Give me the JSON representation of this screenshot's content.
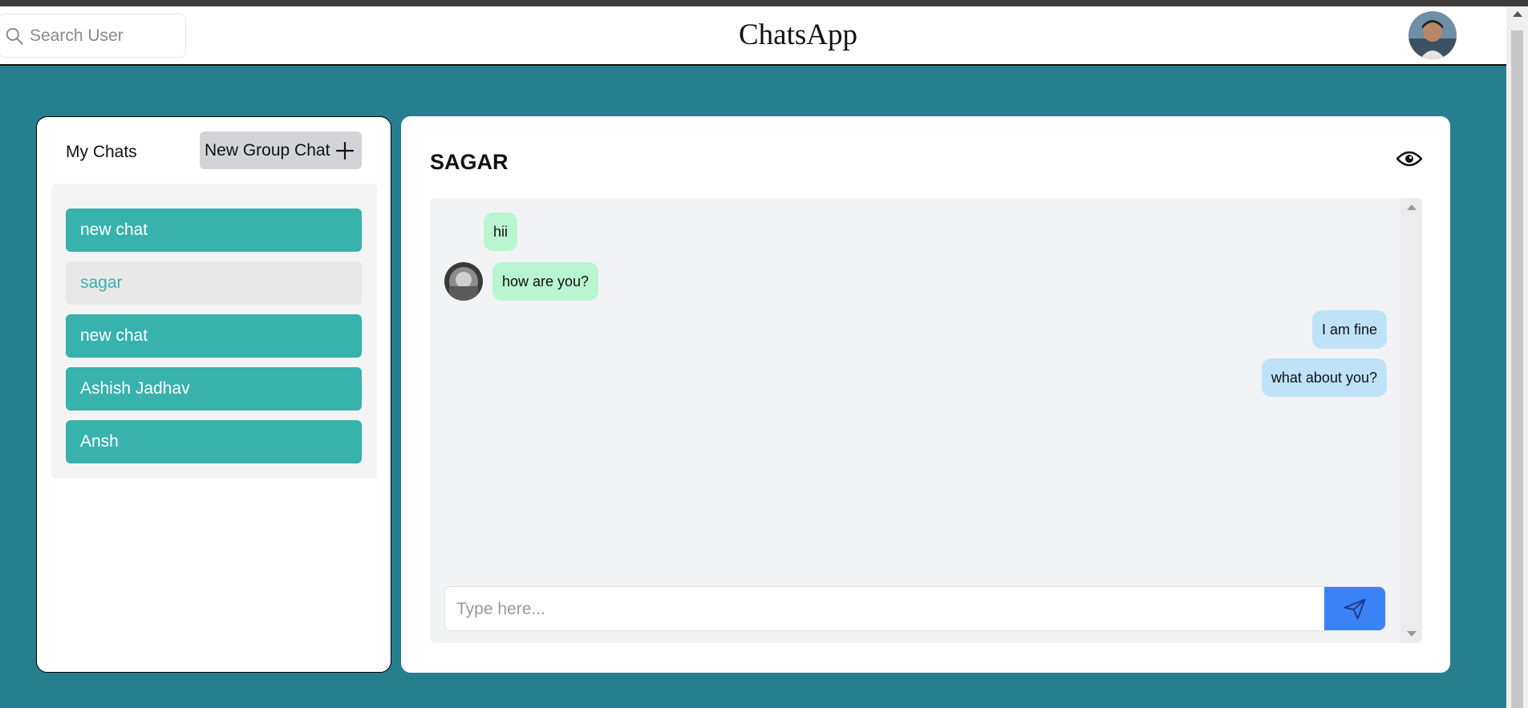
{
  "header": {
    "app_title": "ChatsApp",
    "search_placeholder": "Search User",
    "search_value": ""
  },
  "sidebar": {
    "heading": "My Chats",
    "new_group_label": "New Group Chat",
    "chats": [
      {
        "name": "new chat",
        "selected": false
      },
      {
        "name": "sagar",
        "selected": true
      },
      {
        "name": "new chat",
        "selected": false
      },
      {
        "name": "Ashish Jadhav",
        "selected": false
      },
      {
        "name": "Ansh",
        "selected": false
      }
    ]
  },
  "chat": {
    "title": "SAGAR",
    "messages": [
      {
        "text": "hii",
        "direction": "incoming"
      },
      {
        "text": "how are you?",
        "direction": "incoming"
      },
      {
        "text": "I am fine",
        "direction": "outgoing"
      },
      {
        "text": "what about you?",
        "direction": "outgoing"
      }
    ],
    "input_placeholder": "Type here...",
    "input_value": ""
  },
  "colors": {
    "background": "#267e8f",
    "chat_item": "#38b2ac",
    "incoming_bubble": "#b9f5d0",
    "outgoing_bubble": "#bee3f8",
    "send_button": "#3b82f6"
  },
  "icons": {
    "search": "search-icon",
    "plus": "plus-icon",
    "eye": "eye-icon",
    "send": "send-icon"
  }
}
